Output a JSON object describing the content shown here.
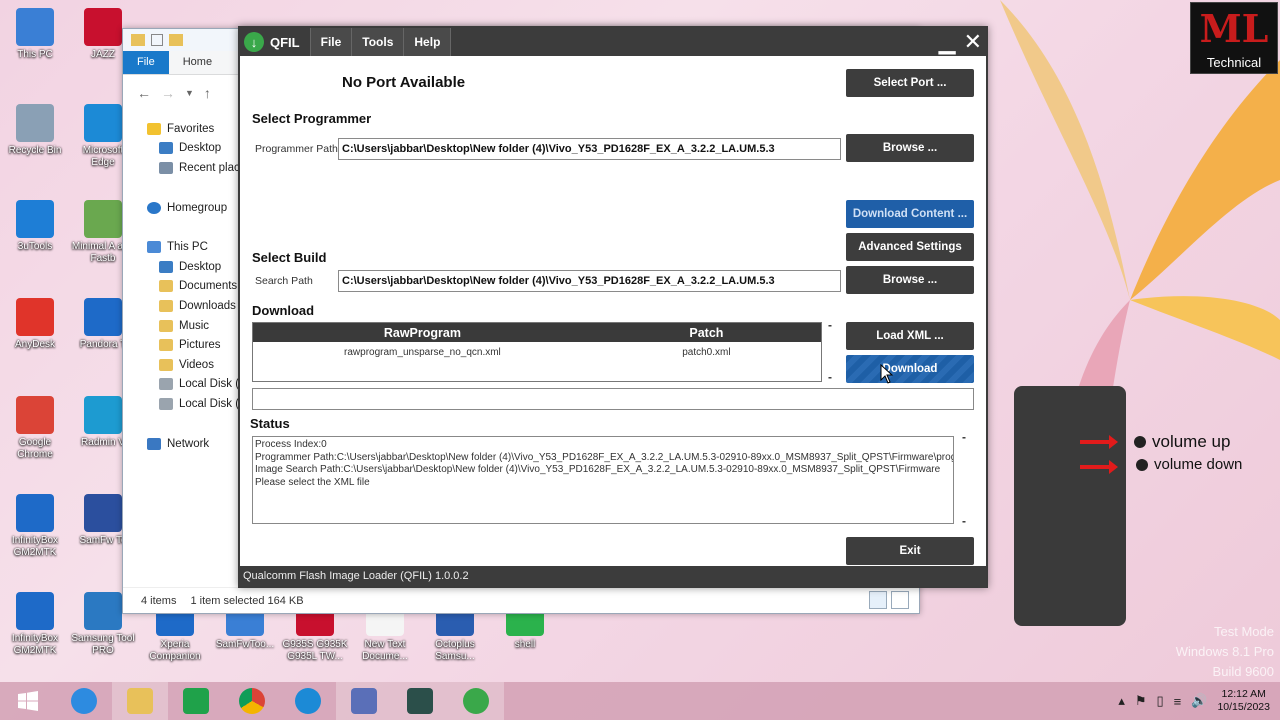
{
  "desktop": {
    "icons_col1": [
      "This PC",
      "Recycle Bin",
      "3uTools",
      "AnyDesk",
      "Google Chrome",
      "InfinityBox GM2MTK",
      "InfinityBox GM2MTK"
    ],
    "icons_col2": [
      "JAZZ",
      "Microsoft Edge",
      "Minimal A and Fastb",
      "Pandora T",
      "Radmin V",
      "SamFw To",
      "Samsung Tool PRO"
    ],
    "icons_bottom": [
      "Xperia Companion",
      "SamFwToo...",
      "G935S G935K G935L TW...",
      "New Text Docume...",
      "Octoplus Samsu...",
      "shell"
    ]
  },
  "explorer": {
    "tabs": [
      "File",
      "Home"
    ],
    "nav": {
      "favorites": "Favorites",
      "desktop": "Desktop",
      "recent": "Recent place",
      "homegroup": "Homegroup",
      "this_pc": "This PC",
      "pc_desktop": "Desktop",
      "documents": "Documents",
      "downloads": "Downloads",
      "music": "Music",
      "pictures": "Pictures",
      "videos": "Videos",
      "local_c": "Local Disk (C",
      "local_e": "Local Disk (E",
      "network": "Network"
    },
    "status": {
      "items": "4 items",
      "selected": "1 item selected  164 KB"
    }
  },
  "qfil": {
    "title": "QFIL",
    "menu": [
      "File",
      "Tools",
      "Help"
    ],
    "port_status": "No Port Available",
    "select_port": "Select Port ...",
    "select_programmer": "Select Programmer",
    "programmer_path_label": "Programmer Path",
    "programmer_path": "C:\\Users\\jabbar\\Desktop\\New folder (4)\\Vivo_Y53_PD1628F_EX_A_3.2.2_LA.UM.5.3",
    "browse": "Browse ...",
    "download_content": "Download Content ...",
    "advanced_settings": "Advanced Settings",
    "select_build": "Select Build",
    "search_path_label": "Search Path",
    "search_path": "C:\\Users\\jabbar\\Desktop\\New folder (4)\\Vivo_Y53_PD1628F_EX_A_3.2.2_LA.UM.5.3",
    "download_heading": "Download",
    "table": {
      "headers": [
        "RawProgram",
        "Patch"
      ],
      "rows": [
        [
          "rawprogram_unsparse_no_qcn.xml",
          "patch0.xml"
        ]
      ]
    },
    "load_xml": "Load XML ...",
    "download_btn": "Download",
    "status_heading": "Status",
    "status_lines": [
      "Process Index:0",
      "Programmer Path:C:\\Users\\jabbar\\Desktop\\New folder (4)\\Vivo_Y53_PD1628F_EX_A_3.2.2_LA.UM.5.3-02910-89xx.0_MSM8937_Split_QPST\\Firmware\\prog",
      "Image Search Path:C:\\Users\\jabbar\\Desktop\\New folder (4)\\Vivo_Y53_PD1628F_EX_A_3.2.2_LA.UM.5.3-02910-89xx.0_MSM8937_Split_QPST\\Firmware",
      "Please select the XML file"
    ],
    "exit": "Exit",
    "footer": "Qualcomm Flash Image Loader (QFIL)   1.0.0.2"
  },
  "phone_diagram": {
    "volume_up": "volume up",
    "volume_down": "volume down"
  },
  "brand": {
    "mark": "ML",
    "tag": "Technical"
  },
  "watermark": [
    "Test Mode",
    "Windows 8.1 Pro",
    "Build 9600"
  ],
  "taskbar": {
    "time": "12:12 AM",
    "date": "10/15/2023"
  }
}
